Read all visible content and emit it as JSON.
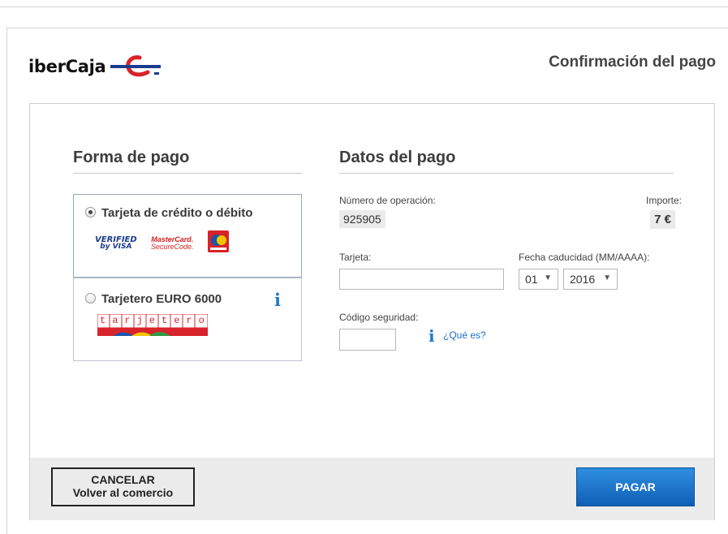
{
  "brand": {
    "name": "iberCaja"
  },
  "header": {
    "title": "Confirmación del pago"
  },
  "payment_method": {
    "title": "Forma de pago",
    "options": [
      {
        "label": "Tarjeta de crédito o débito",
        "selected": true,
        "logos": {
          "verified_l1": "VERIFIED",
          "verified_l2": "by VISA",
          "mastercard_l1": "MasterCard.",
          "mastercard_l2": "SecureCode."
        }
      },
      {
        "label": "Tarjetero EURO 6000",
        "selected": false,
        "logos": {
          "tarjetero_text": "tarjetero"
        }
      }
    ]
  },
  "payment_data": {
    "title": "Datos del pago",
    "operation_label": "Número de operación:",
    "operation_value": "925905",
    "amount_label": "Importe:",
    "amount_value": "7 €",
    "card_label": "Tarjeta:",
    "card_value": "",
    "expiry_label": "Fecha caducidad (MM/AAAA):",
    "expiry_month": "01",
    "expiry_year": "2016",
    "security_label": "Código seguridad:",
    "security_value": "",
    "whats_this": "¿Qué es?"
  },
  "footer": {
    "cancel_line1": "CANCELAR",
    "cancel_line2": "Volver al comercio",
    "pay_label": "PAGAR"
  },
  "colors": {
    "accent_blue": "#1f79c9",
    "brand_red": "#d8232a",
    "pay_button": "#1a72c8"
  },
  "icons": [
    "ibercaja-logo-icon",
    "radio-icon",
    "info-icon",
    "chevron-down-icon"
  ]
}
